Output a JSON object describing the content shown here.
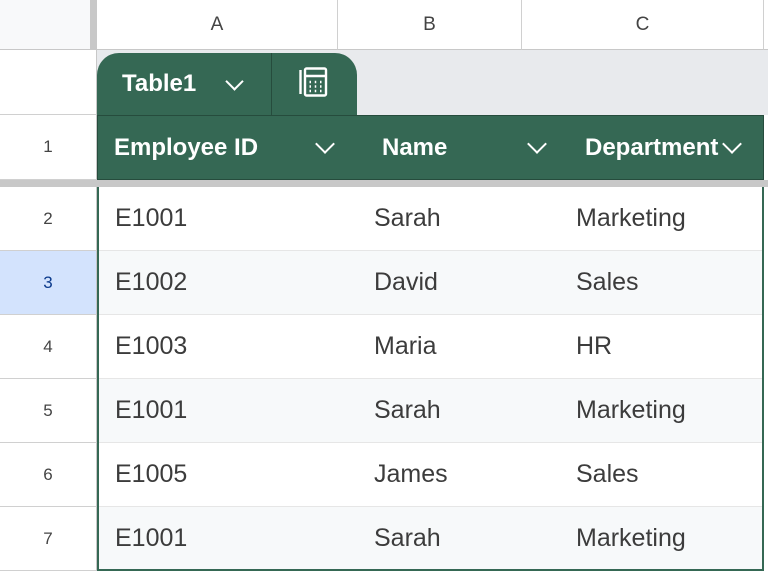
{
  "columns": [
    "A",
    "B",
    "C"
  ],
  "row_numbers": [
    "1",
    "2",
    "3",
    "4",
    "5",
    "6",
    "7"
  ],
  "selected_row": "3",
  "table": {
    "name": "Table1",
    "headers": [
      "Employee ID",
      "Name",
      "Department"
    ],
    "rows": [
      [
        "E1001",
        "Sarah",
        "Marketing"
      ],
      [
        "E1002",
        "David",
        "Sales"
      ],
      [
        "E1003",
        "Maria",
        "HR"
      ],
      [
        "E1001",
        "Sarah",
        "Marketing"
      ],
      [
        "E1005",
        "James",
        "Sales"
      ],
      [
        "E1001",
        "Sarah",
        "Marketing"
      ]
    ]
  },
  "colors": {
    "table_header": "#356854",
    "selected_row_header": "#d3e3fd"
  }
}
